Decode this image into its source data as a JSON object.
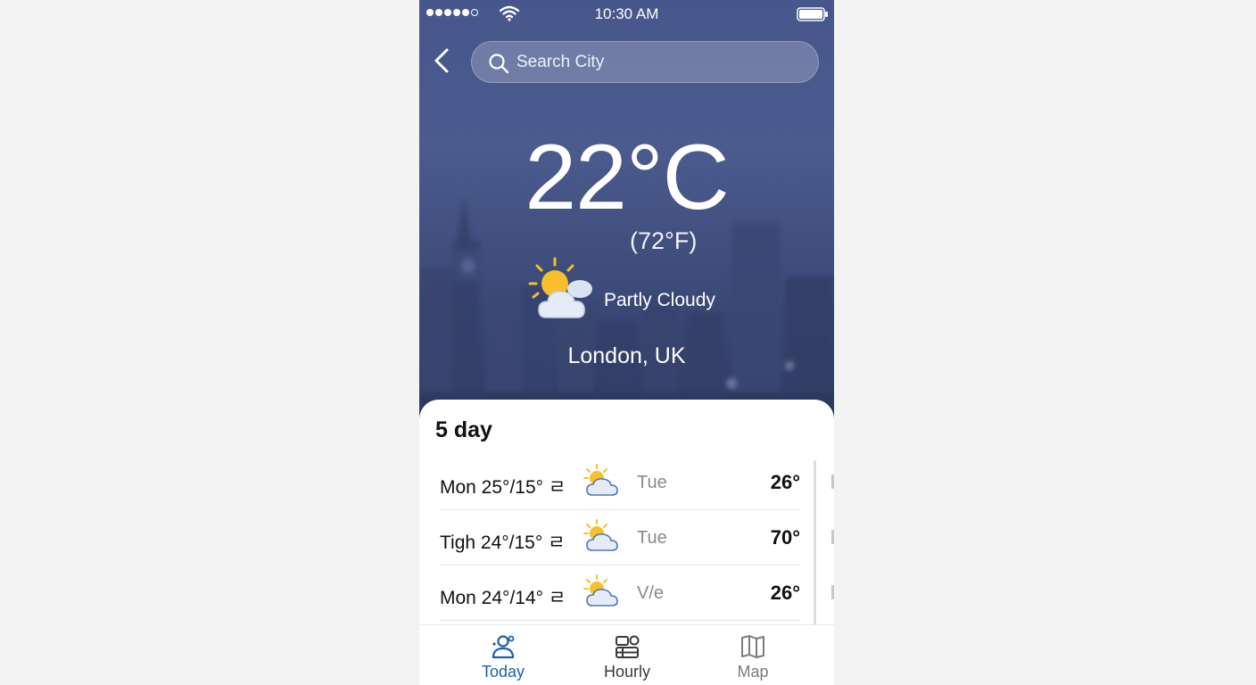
{
  "status_bar": {
    "time": "10:30 AM"
  },
  "search": {
    "placeholder": "Search City"
  },
  "current": {
    "temp_c": "22°C",
    "temp_f": "(72°F)",
    "condition": "Partly Cloudy",
    "condition_icon": "partly-cloudy-icon",
    "location": "London, UK"
  },
  "forecast": {
    "title": "5 day",
    "rows": [
      {
        "lead": "Mon 25°/15° ㄹ",
        "icon": "partly-cloudy-icon",
        "day": "Tue",
        "hi": "26°"
      },
      {
        "lead": "Tigh 24°/15° ㄹ",
        "icon": "partly-cloudy-icon",
        "day": "Tue",
        "hi": "70°"
      },
      {
        "lead": "Mon 24°/14° ㄹ",
        "icon": "partly-cloudy-icon",
        "day": "V/e",
        "hi": "26°"
      }
    ]
  },
  "tabs": [
    {
      "label": "Today",
      "icon": "today-icon",
      "active": true
    },
    {
      "label": "Hourly",
      "icon": "hourly-icon",
      "active": false
    },
    {
      "label": "Map",
      "icon": "map-icon",
      "active": false
    }
  ],
  "colors": {
    "hero_bg": "#47578d",
    "active_tab": "#1f5fa6",
    "inactive_tab": "#3a3a3c",
    "muted_tab": "#7c7c80",
    "sun": "#f7bf2a",
    "cloud": "#dbe3f2"
  }
}
